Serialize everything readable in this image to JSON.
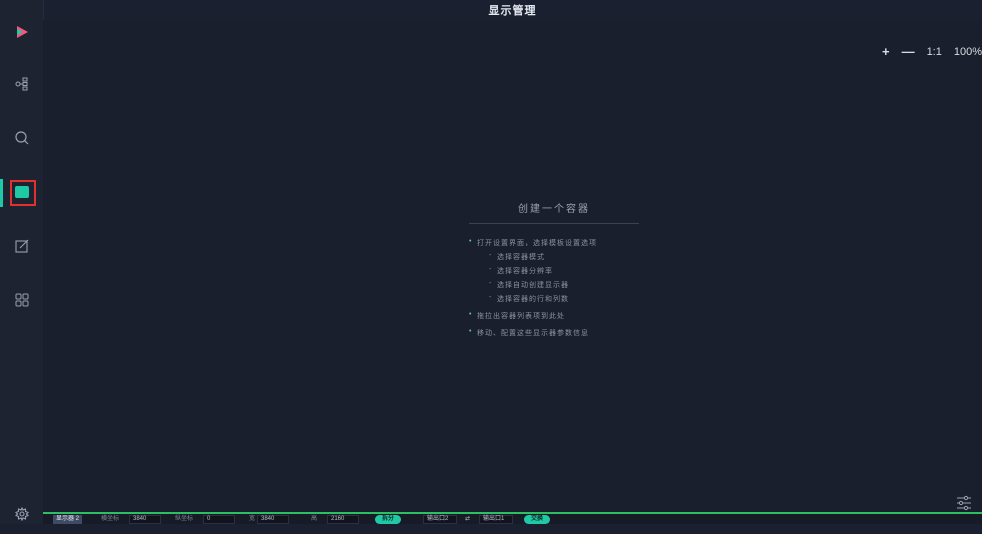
{
  "window": {
    "title": "显示管理"
  },
  "sidebar": {
    "items": [
      {
        "icon": "play-logo-icon"
      },
      {
        "icon": "topology-icon"
      },
      {
        "icon": "search-icon"
      },
      {
        "icon": "display-icon",
        "active": true
      },
      {
        "icon": "edit-icon"
      },
      {
        "icon": "grid-apps-icon"
      },
      {
        "icon": "gear-icon"
      }
    ]
  },
  "toolbar": {
    "zoom_in": "+",
    "zoom_out": "—",
    "fit": "1:1",
    "zoom_level": "100%"
  },
  "guide": {
    "title": "创建一个容器",
    "step1": "打开设置界面，选择模板设置选项",
    "sub1": "选择容器模式",
    "sub2": "选择容器分辨率",
    "sub3": "选择自动创建显示器",
    "sub4": "选择容器的行和列数",
    "step2": "拖拉出容器列表项到此处",
    "step3": "移动、配置这些显示器参数信息"
  },
  "bottombar": {
    "display_name": "显示器 2",
    "x_label": "横坐标",
    "x_value": "3840",
    "y_label": "纵坐标",
    "y_value": "0",
    "width_label": "宽",
    "width_value": "3840",
    "height_label": "高",
    "height_value": "2160",
    "split_button": "拆分",
    "output_a": "输出口2",
    "swap_icon": "⇄",
    "output_b": "输出口1",
    "swap_button": "交换"
  },
  "colors": {
    "accent": "#1fc9a5",
    "highlight": "#e0322a",
    "bottom_border": "#2fbf63"
  }
}
